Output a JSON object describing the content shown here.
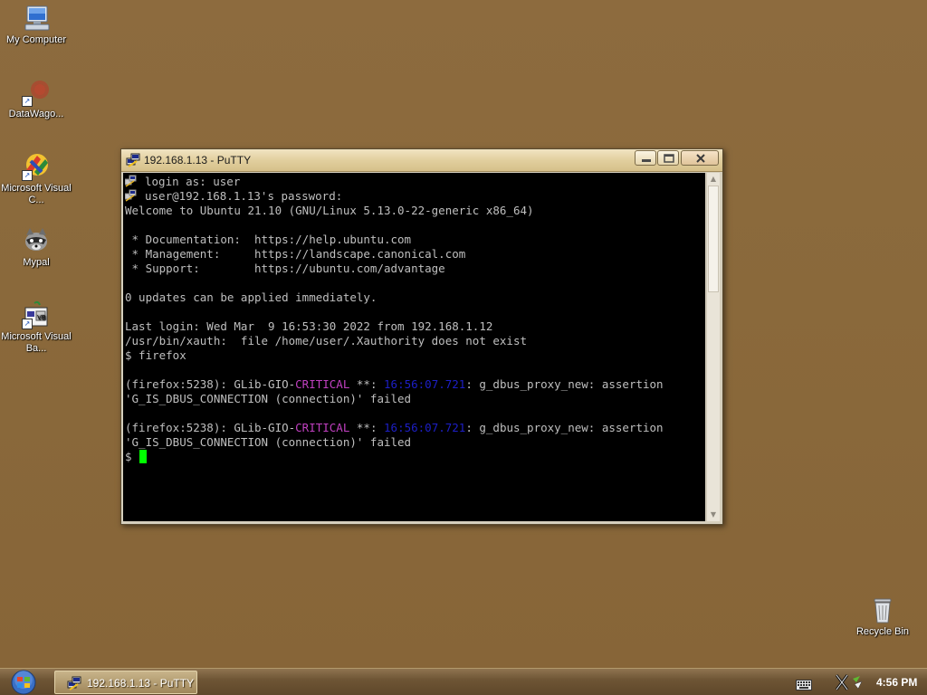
{
  "desktop": {
    "icons": [
      {
        "label": "My Computer",
        "icon": "computer-icon"
      },
      {
        "label": "DataWago...",
        "icon": "datawagon-icon"
      },
      {
        "label": "Microsoft Visual C...",
        "icon": "visual-cpp-icon"
      },
      {
        "label": "Mypal",
        "icon": "mypal-raccoon-icon"
      },
      {
        "label": "Microsoft Visual Ba...",
        "icon": "visual-basic-icon"
      },
      {
        "label": "Recycle Bin",
        "icon": "recycle-bin-icon"
      }
    ]
  },
  "window": {
    "title": "192.168.1.13 - PuTTY",
    "buttons": {
      "minimize": "minimize-icon",
      "maximize": "maximize-icon",
      "close": "close-icon"
    }
  },
  "terminal": {
    "lines": [
      "login as: user",
      "user@192.168.1.13's password:",
      "Welcome to Ubuntu 21.10 (GNU/Linux 5.13.0-22-generic x86_64)",
      "",
      " * Documentation:  https://help.ubuntu.com",
      " * Management:     https://landscape.canonical.com",
      " * Support:        https://ubuntu.com/advantage",
      "",
      "0 updates can be applied immediately.",
      "",
      "Last login: Wed Mar  9 16:53:30 2022 from 192.168.1.12",
      "/usr/bin/xauth:  file /home/user/.Xauthority does not exist",
      "$ firefox",
      "",
      {
        "pre": "(firefox:5238): GLib-GIO-",
        "mag": "CRITICAL",
        "mid": " **: ",
        "blue": "16:56:07.721",
        "post": ": g_dbus_proxy_new: assertion"
      },
      "'G_IS_DBUS_CONNECTION (connection)' failed",
      "",
      {
        "pre": "(firefox:5238): GLib-GIO-",
        "mag": "CRITICAL",
        "mid": " **: ",
        "blue": "16:56:07.721",
        "post": ": g_dbus_proxy_new: assertion"
      },
      "'G_IS_DBUS_CONNECTION (connection)' failed"
    ],
    "prompt": "$"
  },
  "taskbar": {
    "start_icon": "windows-start-orb-icon",
    "task_label": "192.168.1.13 - PuTTY",
    "clock": "4:56 PM"
  },
  "colors": {
    "desktop": "#8b6a3c",
    "terminal_bg": "#000000",
    "terminal_fg": "#bfbfbf",
    "critical": "#c040c0",
    "timestamp": "#1d1fc6",
    "cursor": "#00ff00"
  }
}
